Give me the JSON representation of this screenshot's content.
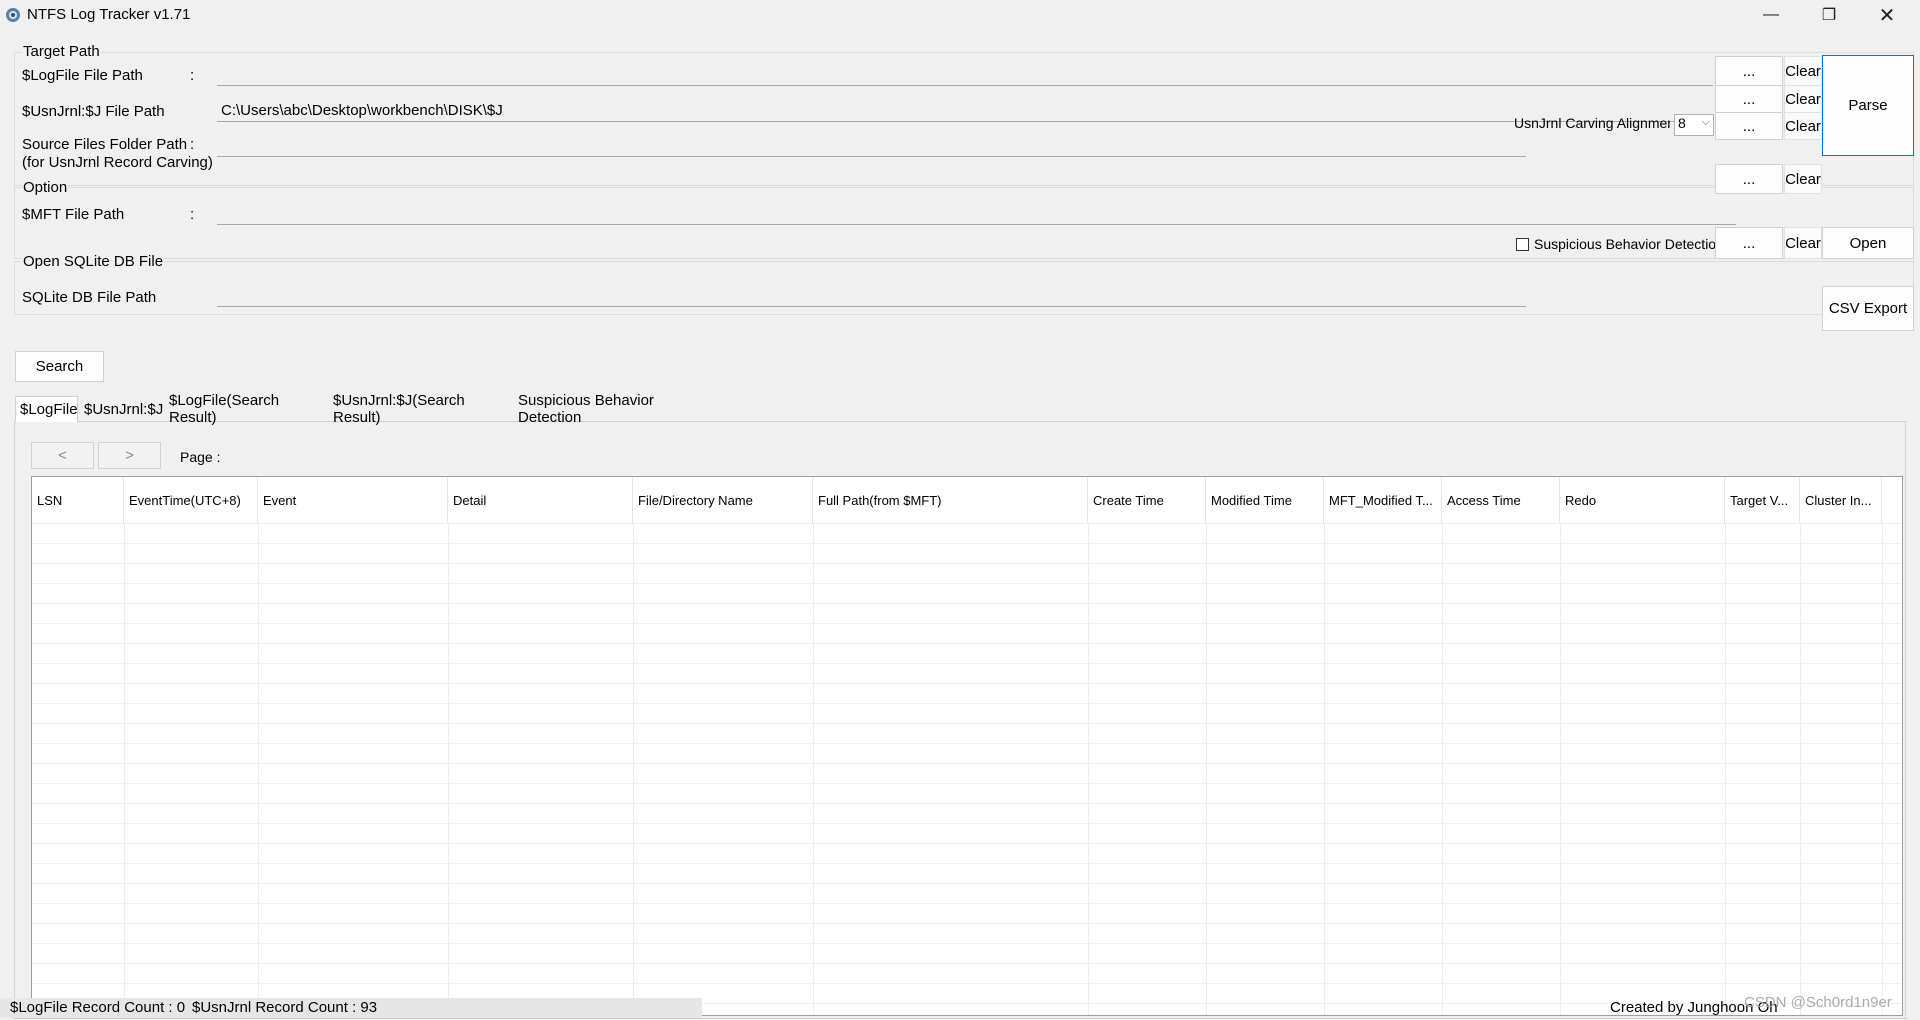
{
  "window": {
    "title": "NTFS Log Tracker v1.71"
  },
  "target_path": {
    "group_title": "Target Path",
    "logfile_label": "$LogFile File Path",
    "logfile_value": "",
    "usnjrnl_label": "$UsnJrnl:$J File Path",
    "usnjrnl_value": "C:\\Users\\abc\\Desktop\\workbench\\DISK\\$J",
    "source_label_1": "Source Files Folder Path",
    "source_label_2": "(for UsnJrnl Record Carving)",
    "source_value": "",
    "carving_label": "UsnJrnl Carving Alignment",
    "carving_value": "8",
    "colon": ":"
  },
  "option": {
    "group_title": "Option",
    "mft_label": "$MFT File Path",
    "mft_value": "",
    "suspicious_checkbox_label": "Suspicious Behavior Detection"
  },
  "sqlite": {
    "group_title": "Open SQLite DB File",
    "db_label": "SQLite DB File Path",
    "db_value": ""
  },
  "buttons": {
    "browse": "...",
    "clear": "Clear",
    "parse": "Parse",
    "open": "Open",
    "csv_export": "CSV Export",
    "search": "Search",
    "prev_page": "<",
    "next_page": ">"
  },
  "tabs": [
    {
      "label": "$LogFile"
    },
    {
      "label": "$UsnJrnl:$J"
    },
    {
      "label": "$LogFile(Search Result)"
    },
    {
      "label": "$UsnJrnl:$J(Search Result)"
    },
    {
      "label": "Suspicious Behavior Detection"
    }
  ],
  "pager": {
    "page_label": "Page :"
  },
  "table": {
    "columns": [
      "LSN",
      "EventTime(UTC+8)",
      "Event",
      "Detail",
      "File/Directory Name",
      "Full Path(from $MFT)",
      "Create Time",
      "Modified Time",
      "MFT_Modified T...",
      "Access Time",
      "Redo",
      "Target V...",
      "Cluster In..."
    ]
  },
  "status": {
    "logfile_count": "$LogFile Record Count : 0",
    "usnjrnl_count": "$UsnJrnl Record Count : 93",
    "created_by": "Created by Junghoon Oh",
    "watermark": "CSDN @Sch0rd1n9er"
  }
}
